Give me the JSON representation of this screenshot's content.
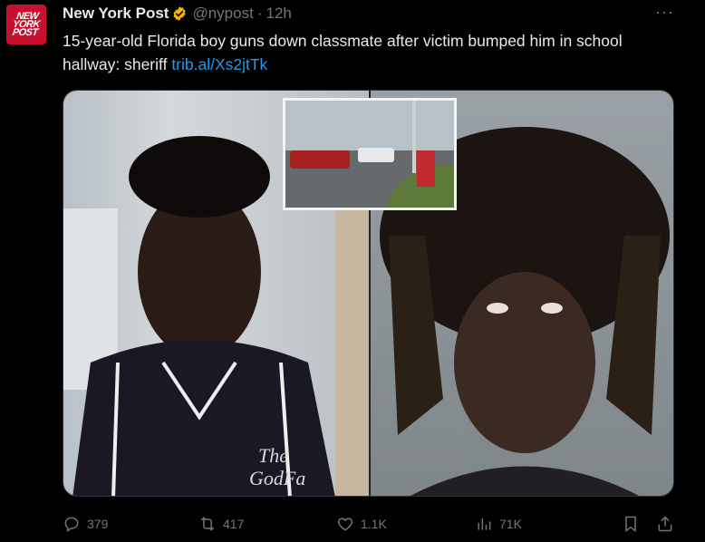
{
  "tweet": {
    "avatar_text": "NEW YORK POST",
    "display_name": "New York Post",
    "handle": "@nypost",
    "separator": "·",
    "time": "12h",
    "more": "···",
    "body_text": "15-year-old Florida boy guns down classmate after victim bumped him in school hallway: sheriff",
    "link_text": "trib.al/Xs2jtTk"
  },
  "actions": {
    "replies": "379",
    "reposts": "417",
    "likes": "1.1K",
    "views": "71K"
  },
  "colors": {
    "background": "#000000",
    "text": "#e7e9ea",
    "muted": "#71767b",
    "link": "#1d9bf0",
    "verified_badge": "#f4b400",
    "brand_red": "#c8102e"
  },
  "icons": [
    "verified-icon",
    "more-icon",
    "reply-icon",
    "repost-icon",
    "like-icon",
    "views-icon",
    "bookmark-icon",
    "share-icon"
  ]
}
